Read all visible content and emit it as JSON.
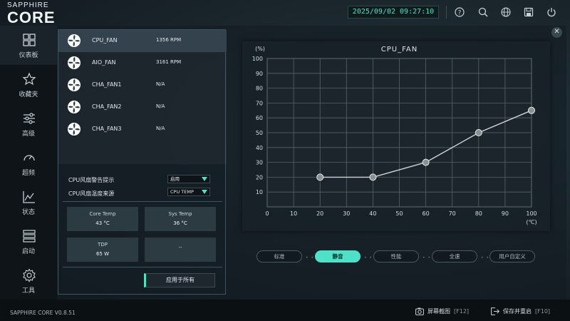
{
  "app": {
    "brand_small": "SAPPHIRE",
    "brand_big": "CORE",
    "version": "SAPPHIRE CORE V0.8.51"
  },
  "topbar": {
    "datetime": "2025/09/02 09:27:10",
    "icons": [
      "help-icon",
      "search-icon",
      "globe-icon",
      "save-icon",
      "power-icon"
    ]
  },
  "sidebar": {
    "items": [
      {
        "label": "仪表板",
        "icon": "dashboard-icon",
        "active": true
      },
      {
        "label": "收藏夹",
        "icon": "star-icon"
      },
      {
        "label": "高级",
        "icon": "sliders-icon"
      },
      {
        "label": "超频",
        "icon": "gauge-icon"
      },
      {
        "label": "状态",
        "icon": "chart-icon"
      },
      {
        "label": "启动",
        "icon": "startup-icon"
      },
      {
        "label": "工具",
        "icon": "gear-icon"
      }
    ]
  },
  "fans": [
    {
      "name": "CPU_FAN",
      "value": "1356 RPM",
      "active": true
    },
    {
      "name": "AIO_FAN",
      "value": "3161 RPM"
    },
    {
      "name": "CHA_FAN1",
      "value": "N/A"
    },
    {
      "name": "CHA_FAN2",
      "value": "N/A"
    },
    {
      "name": "CHA_FAN3",
      "value": "N/A"
    }
  ],
  "settings": {
    "warning_label": "CPU风扇警告提示",
    "warning_value": "启用",
    "source_label": "CPU风扇温度来源",
    "source_value": "CPU TEMP"
  },
  "cards": [
    {
      "title": "Core Temp",
      "value": "43 °C"
    },
    {
      "title": "Sys Temp",
      "value": "36 °C"
    },
    {
      "title": "TDP",
      "value": "65 W"
    },
    {
      "title": "",
      "value": "--"
    }
  ],
  "apply_label": "应用于所有",
  "chart_data": {
    "type": "line",
    "title": "CPU_FAN",
    "ylabel": "(%)",
    "xlabel": "(℃)",
    "xlim": [
      0,
      100
    ],
    "ylim": [
      0,
      100
    ],
    "xticks": [
      0,
      10,
      20,
      30,
      40,
      50,
      60,
      70,
      80,
      90,
      100
    ],
    "yticks": [
      10,
      20,
      30,
      40,
      50,
      60,
      70,
      80,
      90,
      100
    ],
    "grid": true,
    "points": [
      {
        "x": 20,
        "y": 20
      },
      {
        "x": 40,
        "y": 20
      },
      {
        "x": 60,
        "y": 30
      },
      {
        "x": 80,
        "y": 50
      },
      {
        "x": 100,
        "y": 65
      }
    ]
  },
  "presets": [
    {
      "label": "标准"
    },
    {
      "label": "静音",
      "active": true
    },
    {
      "label": "性能"
    },
    {
      "label": "全速"
    },
    {
      "label": "用户自定义"
    }
  ],
  "footer": {
    "screenshot_label": "屏幕截图",
    "screenshot_key": "[F12]",
    "save_label": "保存并重启",
    "save_key": "[F10]"
  },
  "colors": {
    "accent": "#4fe0c8",
    "point_fill": "#8a8f92",
    "curve": "#cfd4d7"
  }
}
